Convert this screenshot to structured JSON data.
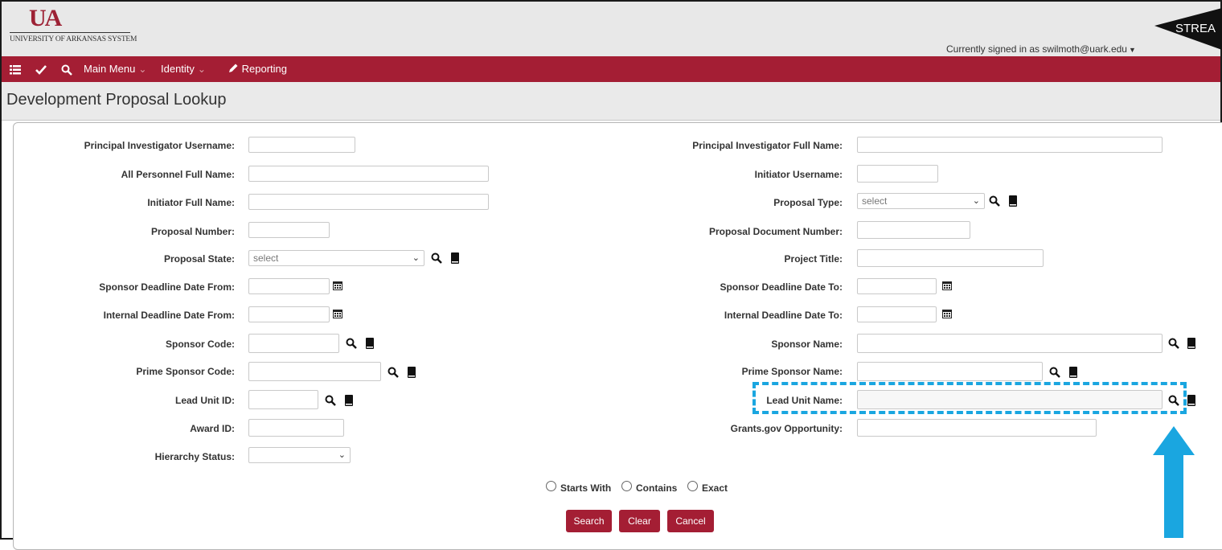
{
  "header": {
    "logo_mark": "UA",
    "logo_text": "UNIVERSITY OF ARKANSAS SYSTEM",
    "brand_partial": "STREA",
    "signed_in_prefix": "Currently signed in as",
    "user_email": "swilmoth@uark.edu"
  },
  "nav": {
    "main_menu": "Main Menu",
    "identity": "Identity",
    "reporting": "Reporting",
    "icons": [
      "list-icon",
      "check-icon",
      "search-icon"
    ]
  },
  "page": {
    "title": "Development Proposal Lookup"
  },
  "form": {
    "left": [
      {
        "label": "Principal Investigator Username:",
        "value": ""
      },
      {
        "label": "All Personnel Full Name:",
        "value": ""
      },
      {
        "label": "Initiator Full Name:",
        "value": ""
      },
      {
        "label": "Proposal Number:",
        "value": ""
      },
      {
        "label": "Proposal State:",
        "value": "select"
      },
      {
        "label": "Sponsor Deadline Date From:",
        "value": ""
      },
      {
        "label": "Internal Deadline Date From:",
        "value": ""
      },
      {
        "label": "Sponsor Code:",
        "value": ""
      },
      {
        "label": "Prime Sponsor Code:",
        "value": ""
      },
      {
        "label": "Lead Unit ID:",
        "value": ""
      },
      {
        "label": "Award ID:",
        "value": ""
      },
      {
        "label": "Hierarchy Status:",
        "value": ""
      }
    ],
    "right": [
      {
        "label": "Principal Investigator Full Name:",
        "value": ""
      },
      {
        "label": "Initiator Username:",
        "value": ""
      },
      {
        "label": "Proposal Type:",
        "value": "select"
      },
      {
        "label": "Proposal Document Number:",
        "value": ""
      },
      {
        "label": "Project Title:",
        "value": ""
      },
      {
        "label": "Sponsor Deadline Date To:",
        "value": ""
      },
      {
        "label": "Internal Deadline Date To:",
        "value": ""
      },
      {
        "label": "Sponsor Name:",
        "value": ""
      },
      {
        "label": "Prime Sponsor Name:",
        "value": ""
      },
      {
        "label": "Lead Unit Name:",
        "value": ""
      },
      {
        "label": "Grants.gov Opportunity:",
        "value": ""
      }
    ],
    "match_options": [
      "Starts With",
      "Contains",
      "Exact"
    ],
    "buttons": {
      "search": "Search",
      "clear": "Clear",
      "cancel": "Cancel"
    }
  },
  "colors": {
    "brand": "#a41e34",
    "annotation": "#1aa6e0"
  }
}
